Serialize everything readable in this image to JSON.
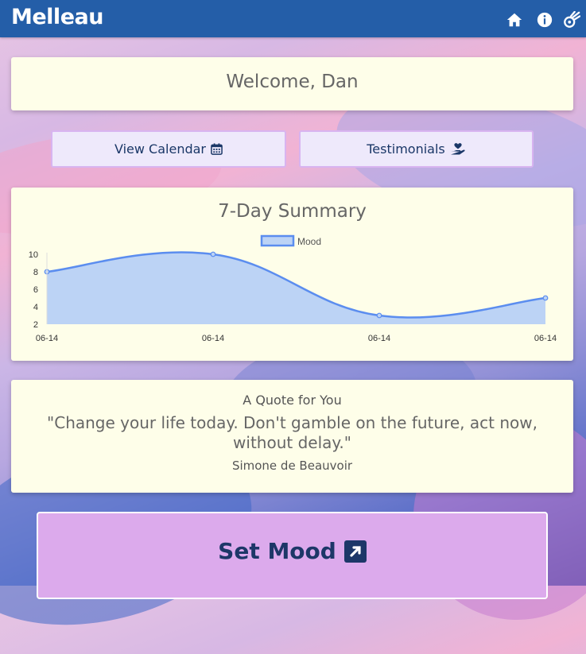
{
  "app": {
    "logo": "Melleau"
  },
  "nav": {
    "icons": [
      "home-icon",
      "info-icon",
      "meteor-icon"
    ]
  },
  "welcome": {
    "text": "Welcome, Dan"
  },
  "buttons": {
    "calendar": {
      "label": "View Calendar",
      "icon": "calendar-icon"
    },
    "testimonials": {
      "label": "Testimonials",
      "icon": "hand-heart-icon"
    }
  },
  "summary": {
    "title": "7-Day Summary"
  },
  "chart_data": {
    "type": "area",
    "title": "7-Day Summary",
    "legend": "top-center",
    "x": [
      "06-14",
      "06-14",
      "06-14",
      "06-14"
    ],
    "series": [
      {
        "name": "Mood",
        "values": [
          8,
          10,
          3,
          5
        ],
        "color": "#5b8def",
        "fill": "#bcd3f5"
      }
    ],
    "y_ticks": [
      2,
      4,
      6,
      8,
      10
    ],
    "ylim": [
      2,
      10
    ],
    "grid": false
  },
  "quote": {
    "heading": "A Quote for You",
    "text": "\"Change your life today. Don't gamble on the future, act now, without delay.\"",
    "author": "Simone de Beauvoir"
  },
  "cta": {
    "label": "Set Mood",
    "icon": "external-link-icon"
  },
  "colors": {
    "navbar": "#245ea8",
    "card": "#fefee9",
    "button_border": "#d8b4f0",
    "cta": "#dcaaec"
  }
}
